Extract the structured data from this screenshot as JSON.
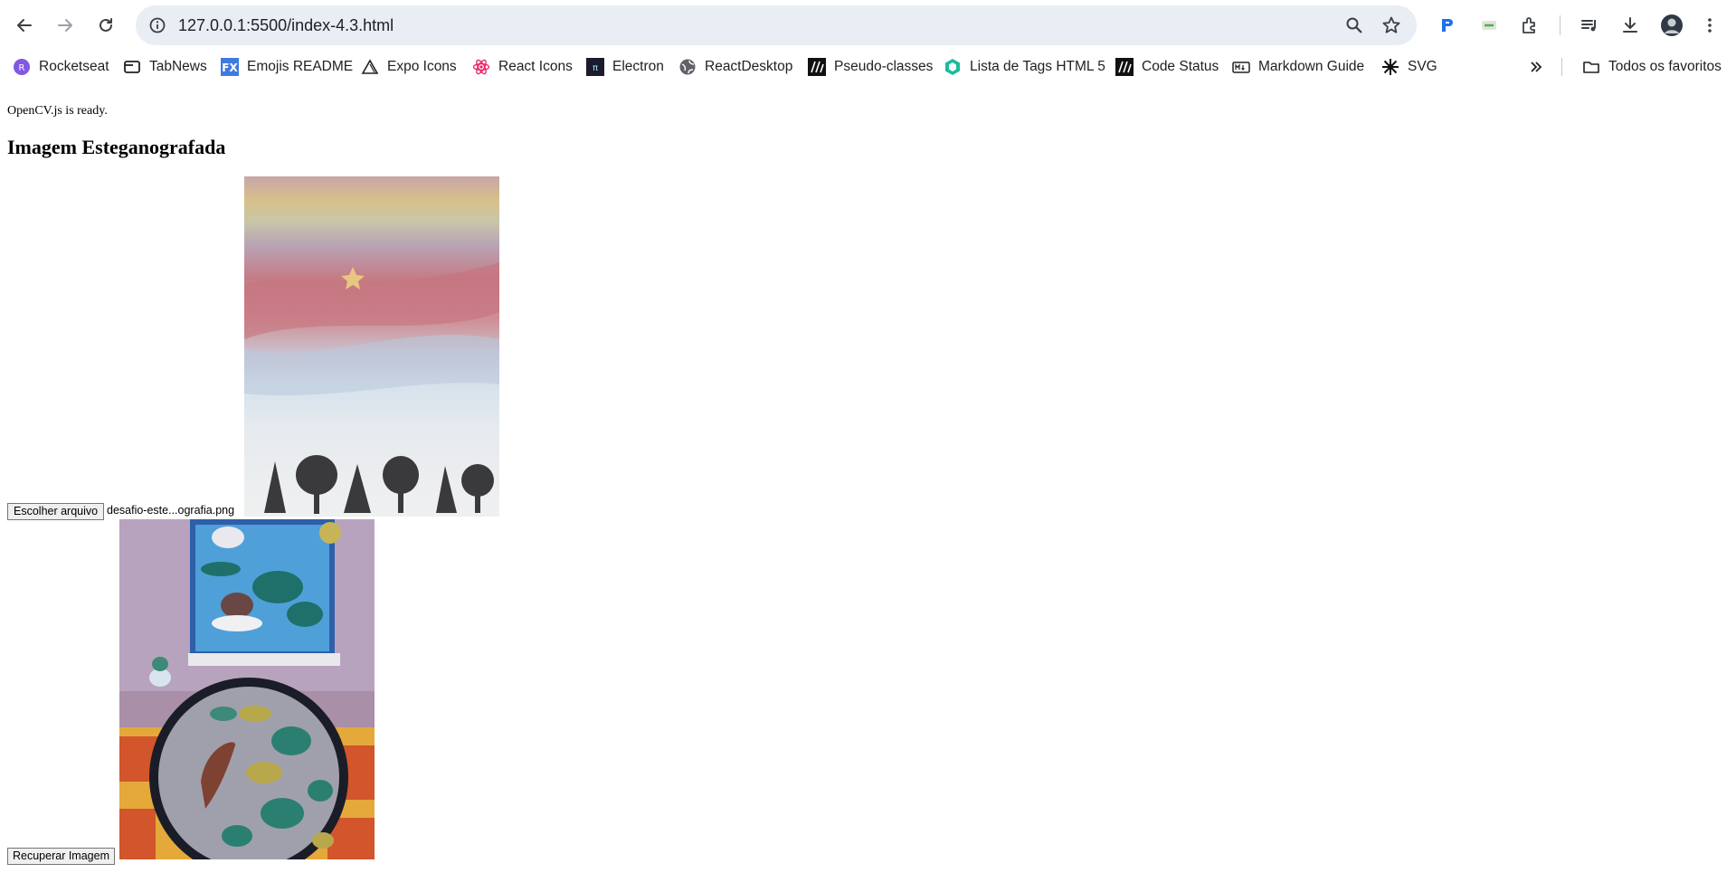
{
  "browser": {
    "url": "127.0.0.1:5500/index-4.3.html",
    "bookmarks": [
      {
        "label": "Rocketseat",
        "icon": "rocketseat-icon"
      },
      {
        "label": "TabNews",
        "icon": "tabnews-icon"
      },
      {
        "label": "Emojis README",
        "icon": "fx-icon"
      },
      {
        "label": "Expo Icons",
        "icon": "expo-icon"
      },
      {
        "label": "React Icons",
        "icon": "react-icon"
      },
      {
        "label": "Electron",
        "icon": "electron-icon"
      },
      {
        "label": "ReactDesktop",
        "icon": "globe-icon"
      },
      {
        "label": "Pseudo-classes",
        "icon": "mdn-icon"
      },
      {
        "label": "Lista de Tags HTML 5",
        "icon": "hexagon-icon"
      },
      {
        "label": "Code Status",
        "icon": "mdn-icon"
      },
      {
        "label": "Markdown Guide",
        "icon": "markdown-icon"
      },
      {
        "label": "SVG",
        "icon": "svg-icon"
      }
    ],
    "all_bookmarks_label": "Todos os favoritos"
  },
  "page": {
    "status": "OpenCV.js is ready.",
    "heading": "Imagem Esteganografada",
    "file_button": "Escolher arquivo",
    "file_name": "desafio-este...ografia.png",
    "recover_button": "Recuperar Imagem"
  }
}
